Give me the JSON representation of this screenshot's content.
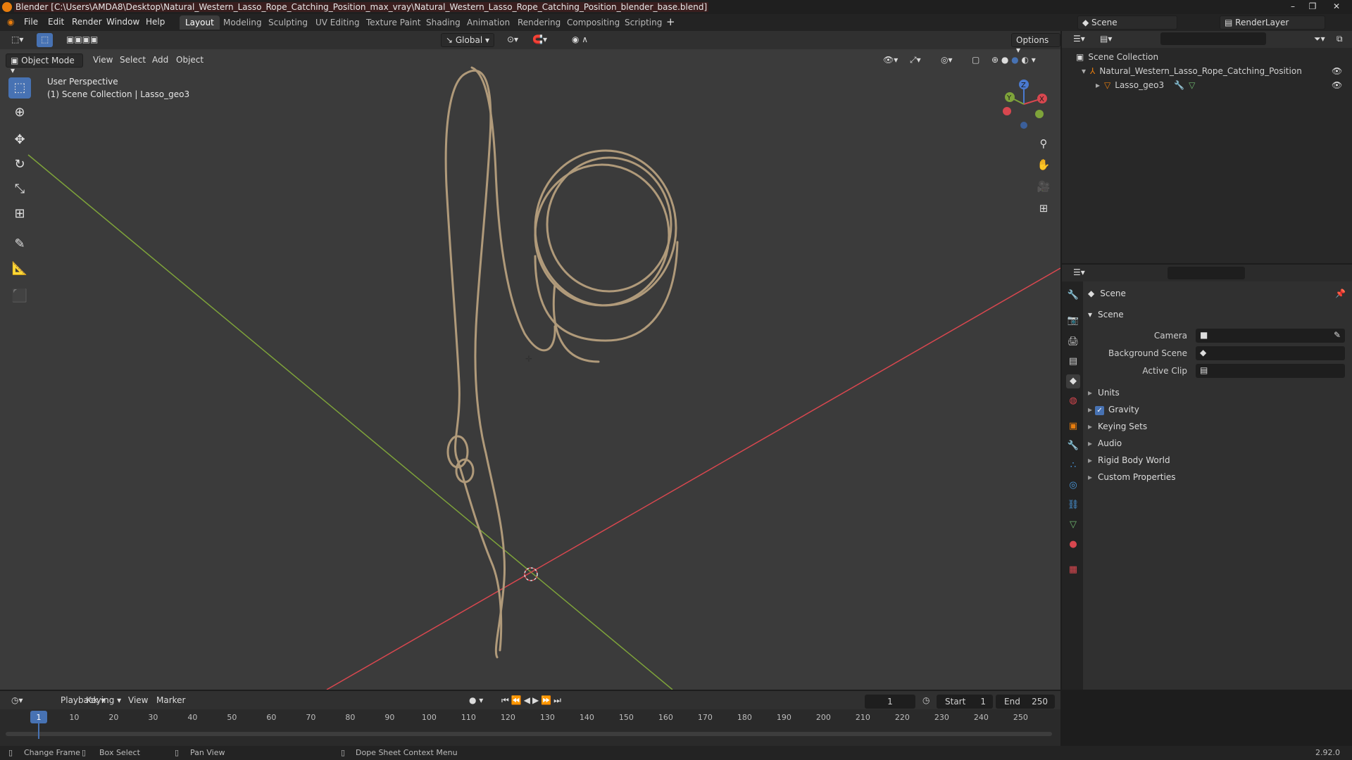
{
  "window": {
    "title": "Blender [C:\\Users\\AMDA8\\Desktop\\Natural_Western_Lasso_Rope_Catching_Position_max_vray\\Natural_Western_Lasso_Rope_Catching_Position_blender_base.blend]"
  },
  "menubar": {
    "menus": [
      "File",
      "Edit",
      "Render",
      "Window",
      "Help"
    ],
    "workspaces": [
      "Layout",
      "Modeling",
      "Sculpting",
      "UV Editing",
      "Texture Paint",
      "Shading",
      "Animation",
      "Rendering",
      "Compositing",
      "Scripting"
    ],
    "active_workspace": "Layout",
    "scene": "Scene",
    "view_layer": "RenderLayer"
  },
  "viewport_header": {
    "mode": "Object Mode",
    "menus": [
      "View",
      "Select",
      "Add",
      "Object"
    ],
    "transform_orientation": "Global",
    "options": "Options"
  },
  "viewport": {
    "perspective": "User Perspective",
    "collection": "(1) Scene Collection | Lasso_geo3",
    "gizmo_axes": [
      "X",
      "Y",
      "Z"
    ],
    "colors": {
      "x_axis": "#d8474f",
      "y_axis": "#7ea33a",
      "rope": "#b09a7a",
      "active": "#4772b3"
    }
  },
  "outliner": {
    "root": "Scene Collection",
    "items": [
      "Natural_Western_Lasso_Rope_Catching_Position",
      "Lasso_geo3"
    ]
  },
  "properties": {
    "context": "Scene",
    "panel": "Scene",
    "fields": [
      {
        "label": "Camera",
        "value": ""
      },
      {
        "label": "Background Scene",
        "value": ""
      },
      {
        "label": "Active Clip",
        "value": ""
      }
    ],
    "subpanels": [
      "Units",
      "Gravity",
      "Keying Sets",
      "Audio",
      "Rigid Body World",
      "Custom Properties"
    ],
    "gravity_checked": true
  },
  "timeline": {
    "menus": [
      "Playback",
      "Keying",
      "View",
      "Marker"
    ],
    "current_frame": "1",
    "start_label": "Start",
    "start": "1",
    "end_label": "End",
    "end": "250",
    "ticks": [
      "1",
      "10",
      "20",
      "30",
      "40",
      "50",
      "60",
      "70",
      "80",
      "90",
      "100",
      "110",
      "120",
      "130",
      "140",
      "150",
      "160",
      "170",
      "180",
      "190",
      "200",
      "210",
      "220",
      "230",
      "240",
      "250"
    ]
  },
  "statusbar": {
    "items": [
      "Change Frame",
      "Box Select",
      "Pan View",
      "Dope Sheet Context Menu"
    ],
    "version": "2.92.0"
  }
}
